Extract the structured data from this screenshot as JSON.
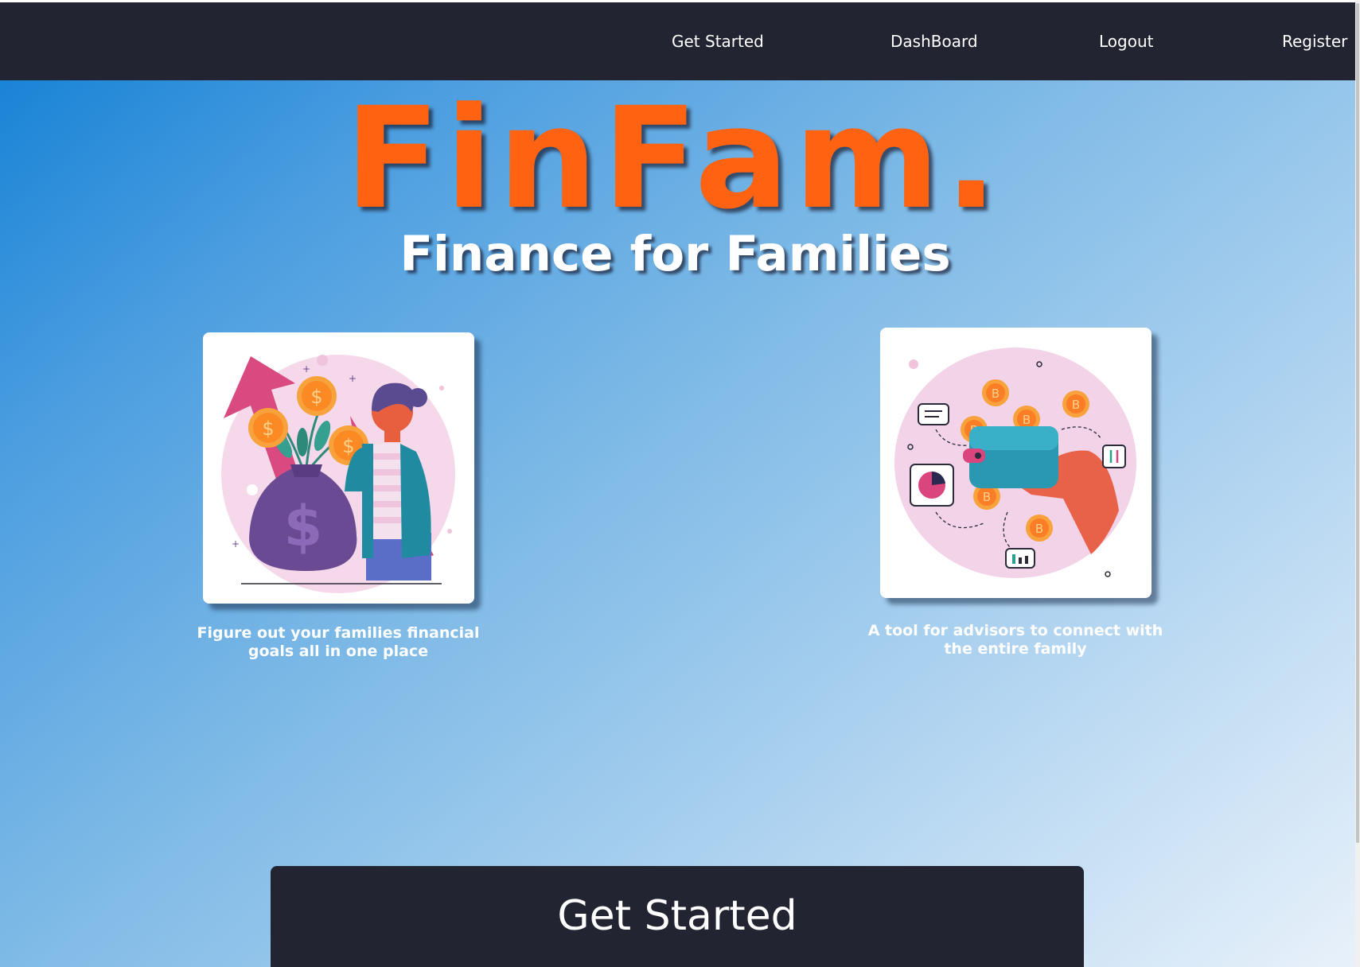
{
  "nav": {
    "items": [
      {
        "label": "Get Started"
      },
      {
        "label": "DashBoard"
      },
      {
        "label": "Logout"
      },
      {
        "label": "Register"
      }
    ]
  },
  "hero": {
    "title": "FinFam.",
    "subtitle": "Finance for Families"
  },
  "features": [
    {
      "icon": "money-bag-illustration",
      "caption": "Figure out your families financial goals all in one place"
    },
    {
      "icon": "wallet-bitcoin-illustration",
      "caption": "A tool for advisors to connect with the entire family"
    }
  ],
  "cta": {
    "label": "Get Started"
  },
  "colors": {
    "brand": "#ff6210",
    "nav_bg": "#222431",
    "gradient_start": "#0f7ed4",
    "gradient_end": "#e8f1fa"
  }
}
